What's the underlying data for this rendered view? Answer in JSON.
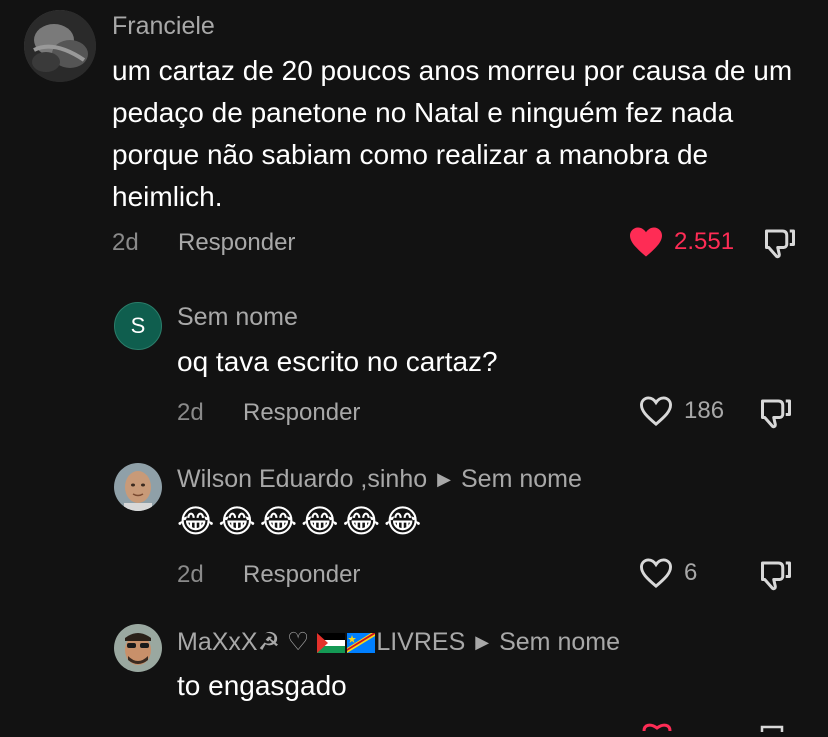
{
  "comments": [
    {
      "author": "Franciele",
      "text": "um cartaz de 20 poucos anos morreu por causa de um pedaço de panetone no Natal e ninguém fez nada porque não sabiam como realizar a manobra de heimlich.",
      "time": "2d",
      "reply_label": "Responder",
      "likes": "2.551",
      "liked": true
    },
    {
      "author": "Sem nome",
      "avatar_letter": "S",
      "avatar_color": "#0f5e4e",
      "text": "oq tava escrito no cartaz?",
      "time": "2d",
      "reply_label": "Responder",
      "likes": "186"
    },
    {
      "author": "Wilson Eduardo ,sinho",
      "reply_to": "Sem nome",
      "emoji_text": "😂😂😂😂😂😂",
      "time": "2d",
      "reply_label": "Responder",
      "likes": "6"
    },
    {
      "author_prefix": "MaXxX☭ ♡",
      "author_suffix": "LIVRES",
      "reply_to": "Sem nome",
      "text": "to engasgado"
    }
  ],
  "colors": {
    "background": "#121212",
    "like_active": "#fe2c55",
    "muted": "#a8a8a8"
  }
}
